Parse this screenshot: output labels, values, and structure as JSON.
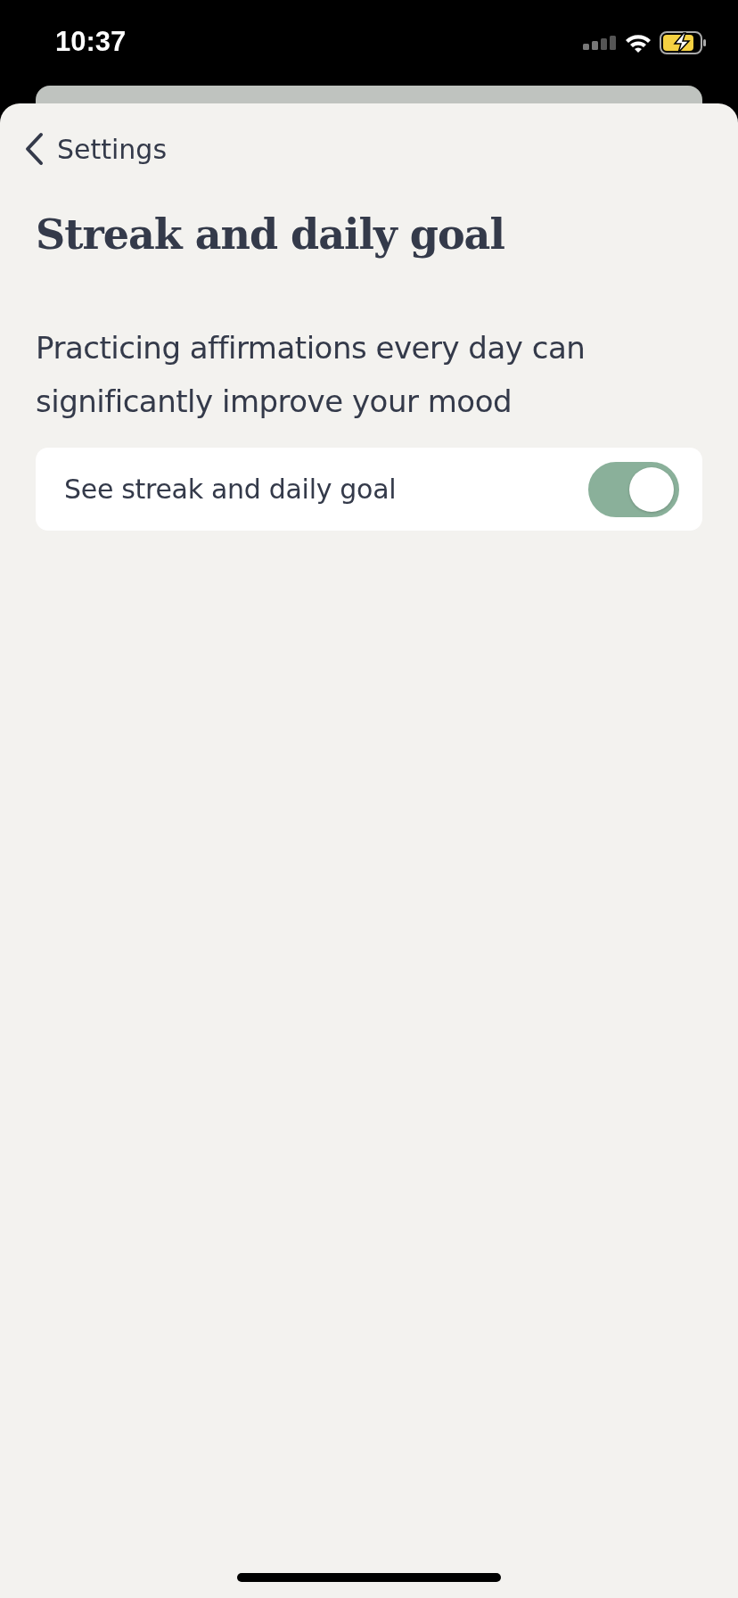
{
  "status_bar": {
    "time": "10:37"
  },
  "nav": {
    "back_label": "Settings"
  },
  "title": "Streak and daily goal",
  "description": "Practicing affirmations every day can significantly improve your mood",
  "settings": [
    {
      "label": "See streak and daily goal",
      "on": true
    }
  ]
}
